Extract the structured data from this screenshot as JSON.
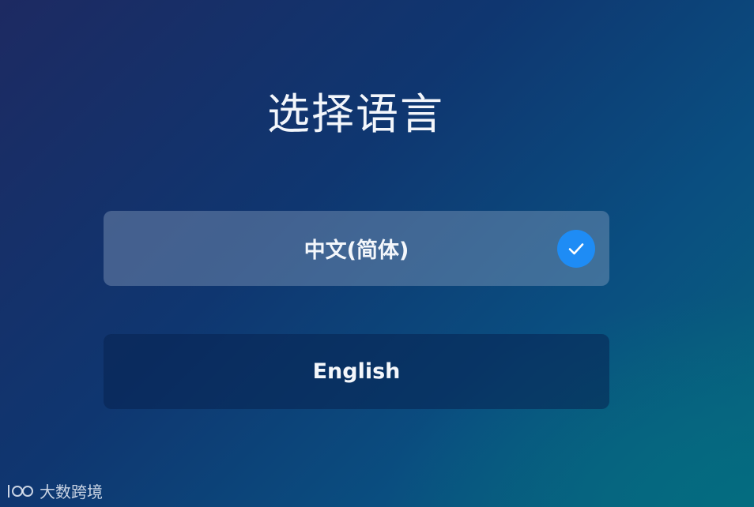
{
  "page": {
    "title": "选择语言"
  },
  "options": [
    {
      "label": "中文(简体)",
      "selected": true
    },
    {
      "label": "English",
      "selected": false
    }
  ],
  "icons": {
    "selected": "check-circle-icon",
    "watermark": "watermark-logo"
  },
  "colors": {
    "accent": "#1e8cf5",
    "background_start": "#1d2a62",
    "background_end": "#07667e"
  },
  "watermark": {
    "text": "大数跨境"
  }
}
